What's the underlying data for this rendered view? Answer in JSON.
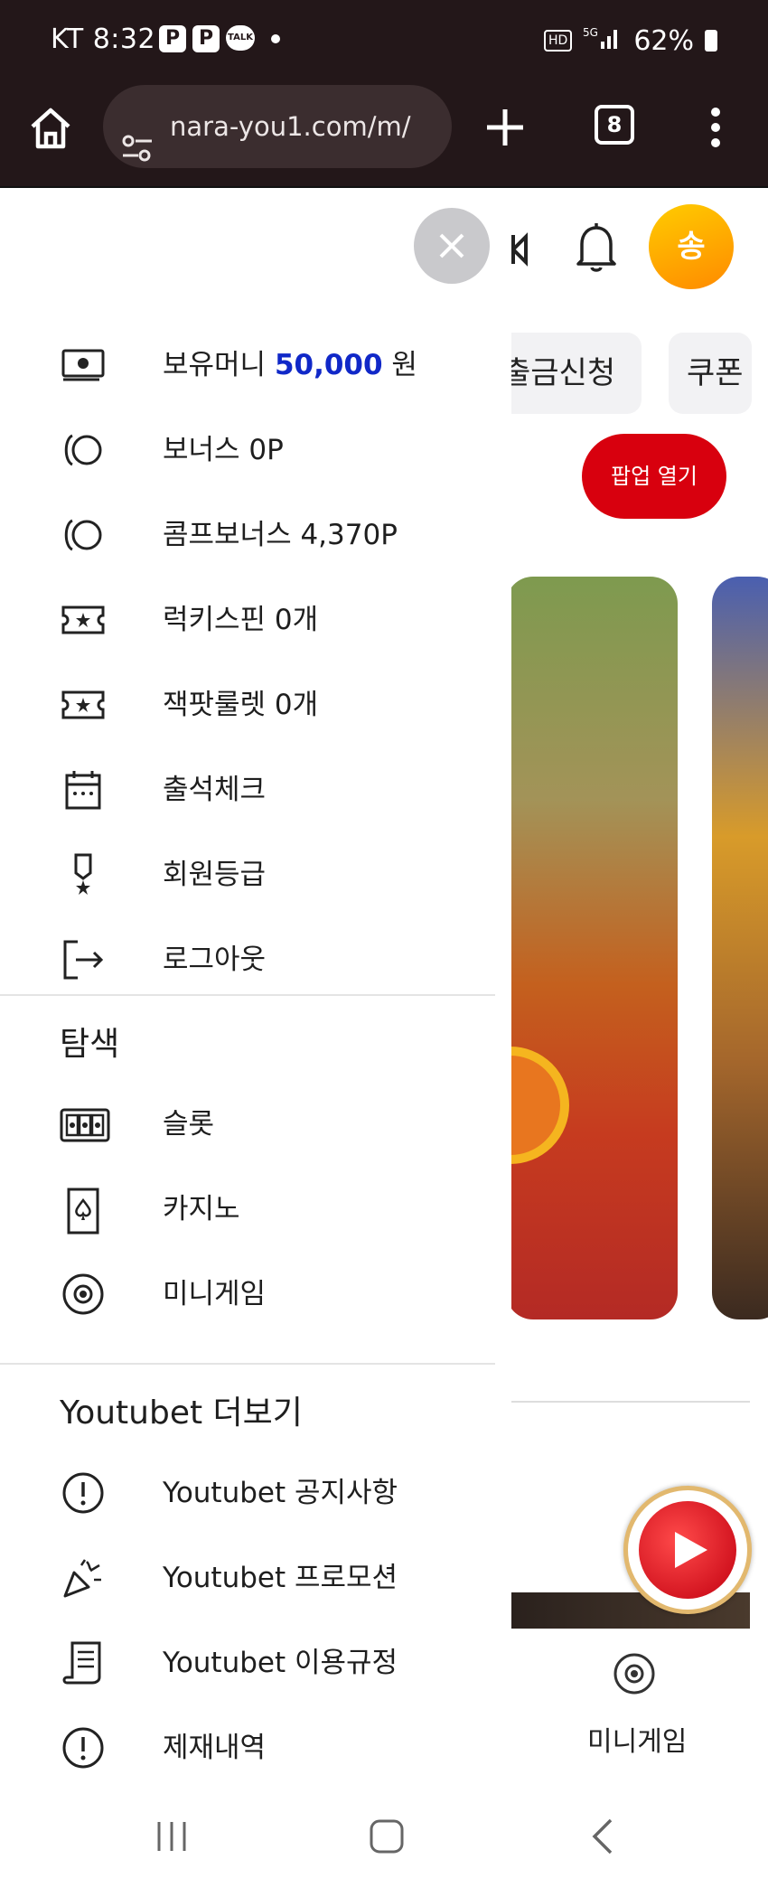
{
  "status_bar": {
    "time": "KT 8:32",
    "notif_p1": "P",
    "notif_p2": "P",
    "notif_talk": "TALK",
    "battery": "62%"
  },
  "browser": {
    "url": "nara-you1.com/m/",
    "tab_count": "8"
  },
  "background_page": {
    "avatar_initial": "송",
    "chip_withdraw": "출금신청",
    "chip_coupon": "쿠폰",
    "popup_button": "팝업 열기",
    "bottom_label": "미니게임"
  },
  "drawer": {
    "account_items": [
      {
        "icon": "wallet-icon",
        "label_prefix": "보유머니 ",
        "amount": "50,000",
        "label_suffix": " 원"
      },
      {
        "icon": "coin-icon",
        "label": "보너스 0P"
      },
      {
        "icon": "coin-icon",
        "label": "콤프보너스 4,370P"
      },
      {
        "icon": "ticket-icon",
        "label": "럭키스핀 0개"
      },
      {
        "icon": "ticket-icon",
        "label": "잭팟룰렛 0개"
      },
      {
        "icon": "calendar-icon",
        "label": "출석체크"
      },
      {
        "icon": "medal-icon",
        "label": "회원등급"
      },
      {
        "icon": "logout-icon",
        "label": "로그아웃"
      }
    ],
    "explore_heading": "탐색",
    "explore_items": [
      {
        "icon": "slot-icon",
        "label": "슬롯"
      },
      {
        "icon": "card-icon",
        "label": "카지노"
      },
      {
        "icon": "chip-icon",
        "label": "미니게임"
      }
    ],
    "more_heading": "Youtubet 더보기",
    "more_items": [
      {
        "icon": "alert-icon",
        "label": "Youtubet 공지사항"
      },
      {
        "icon": "party-popper-icon",
        "label": "Youtubet 프로모션"
      },
      {
        "icon": "document-icon",
        "label": "Youtubet 이용규정"
      },
      {
        "icon": "alert-icon",
        "label": "제재내역"
      }
    ]
  }
}
